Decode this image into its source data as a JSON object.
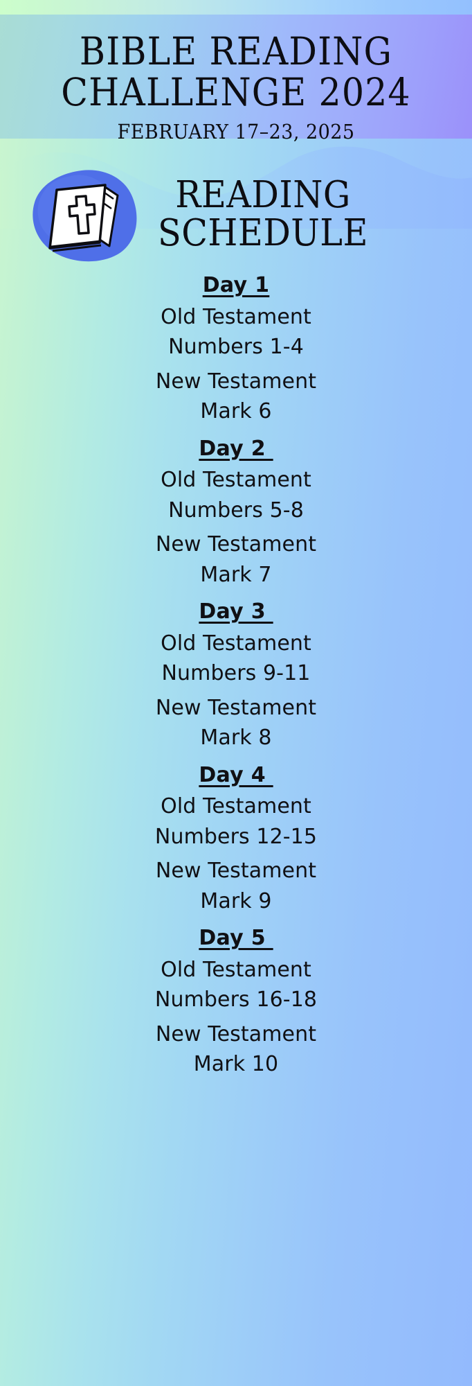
{
  "header": {
    "title_line_1": "BIBLE READING",
    "title_line_2": "CHALLENGE 2024",
    "date_range": "FEBRUARY 17–23, 2025"
  },
  "section": {
    "heading_line_1": "READING",
    "heading_line_2": "SCHEDULE",
    "icon": "bible-book-cross-icon"
  },
  "colors": {
    "accent_blue_blob": "#4f6fe8",
    "text": "#101014",
    "gradient_left": "#c9f5cf",
    "gradient_right": "#93bafd",
    "header_gradient_right": "#9a8cfa"
  },
  "schedule": {
    "old_testament_label": "Old Testament",
    "new_testament_label": "New Testament",
    "days": [
      {
        "label": "Day 1",
        "ot_book": "Numbers 1-4",
        "nt_book": "Mark 6"
      },
      {
        "label": "Day 2 ",
        "ot_book": "Numbers 5-8",
        "nt_book": "Mark 7"
      },
      {
        "label": "Day 3 ",
        "ot_book": "Numbers 9-11",
        "nt_book": "Mark 8"
      },
      {
        "label": "Day 4 ",
        "ot_book": "Numbers 12-15",
        "nt_book": "Mark 9"
      },
      {
        "label": "Day 5 ",
        "ot_book": "Numbers 16-18",
        "nt_book": "Mark 10"
      }
    ]
  }
}
